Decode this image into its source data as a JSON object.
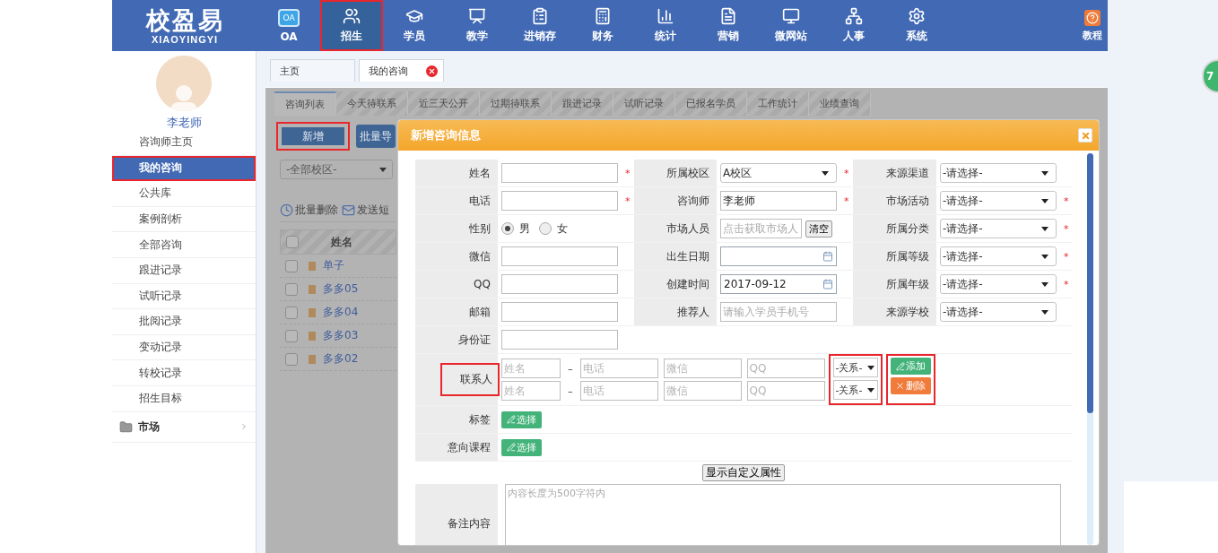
{
  "logo": {
    "title": "校盈易",
    "subtitle": "XIAOYINGYI"
  },
  "nav": [
    {
      "label": "OA",
      "icon_text": "OA",
      "selected": false,
      "highlighted": false
    },
    {
      "label": "招生",
      "selected": true,
      "highlighted": true
    },
    {
      "label": "学员",
      "selected": false,
      "highlighted": false
    },
    {
      "label": "教学",
      "selected": false,
      "highlighted": false
    },
    {
      "label": "进销存",
      "selected": false,
      "highlighted": false
    },
    {
      "label": "财务",
      "selected": false,
      "highlighted": false
    },
    {
      "label": "统计",
      "selected": false,
      "highlighted": false
    },
    {
      "label": "营销",
      "selected": false,
      "highlighted": false
    },
    {
      "label": "微网站",
      "selected": false,
      "highlighted": false
    },
    {
      "label": "人事",
      "selected": false,
      "highlighted": false
    },
    {
      "label": "系统",
      "selected": false,
      "highlighted": false
    }
  ],
  "help": {
    "label": "教程"
  },
  "user": {
    "name": "李老师"
  },
  "sidebar": {
    "items": [
      {
        "label": "咨询师主页",
        "selected": false,
        "highlighted": false
      },
      {
        "label": "我的咨询",
        "selected": true,
        "highlighted": true
      },
      {
        "label": "公共库",
        "selected": false,
        "highlighted": false
      },
      {
        "label": "案例剖析",
        "selected": false,
        "highlighted": false
      },
      {
        "label": "全部咨询",
        "selected": false,
        "highlighted": false
      },
      {
        "label": "跟进记录",
        "selected": false,
        "highlighted": false
      },
      {
        "label": "试听记录",
        "selected": false,
        "highlighted": false
      },
      {
        "label": "批阅记录",
        "selected": false,
        "highlighted": false
      },
      {
        "label": "变动记录",
        "selected": false,
        "highlighted": false
      },
      {
        "label": "转校记录",
        "selected": false,
        "highlighted": false
      },
      {
        "label": "招生目标",
        "selected": false,
        "highlighted": false
      }
    ],
    "group": {
      "label": "市场",
      "expanded": false
    }
  },
  "page_tabs": [
    {
      "label": "主页",
      "selected": false,
      "closable": false
    },
    {
      "label": "我的咨询",
      "selected": true,
      "closable": true
    }
  ],
  "sub_tabs": [
    {
      "label": "咨询列表",
      "selected": true
    },
    {
      "label": "今天待联系",
      "selected": false
    },
    {
      "label": "近三天公开",
      "selected": false
    },
    {
      "label": "过期待联系",
      "selected": false
    },
    {
      "label": "跟进记录",
      "selected": false
    },
    {
      "label": "试听记录",
      "selected": false
    },
    {
      "label": "已报名学员",
      "selected": false
    },
    {
      "label": "工作统计",
      "selected": false
    },
    {
      "label": "业绩查询",
      "selected": false
    }
  ],
  "toolbar": {
    "buttons": [
      {
        "label": "新增",
        "highlighted": true
      },
      {
        "label": "批量导",
        "highlighted": false
      }
    ],
    "campus_select": "-全部校区-",
    "actions": [
      "批量删除",
      "发送短"
    ]
  },
  "list": {
    "header": {
      "label": "姓名",
      "checked": false
    },
    "rows": [
      {
        "name": "单子",
        "checked": false
      },
      {
        "name": "多多05",
        "checked": false
      },
      {
        "name": "多多04",
        "checked": false
      },
      {
        "name": "多多03",
        "checked": false
      },
      {
        "name": "多多02",
        "checked": false
      }
    ]
  },
  "dialog": {
    "title": "新增咨询信息",
    "rows": [
      [
        {
          "kind": "text",
          "label": "姓名",
          "required_mark": "*"
        },
        {
          "kind": "select",
          "label": "所属校区",
          "value": "A校区",
          "required_mark": "*"
        },
        {
          "kind": "select",
          "label": "来源渠道",
          "value": "-请选择-"
        }
      ],
      [
        {
          "kind": "text",
          "label": "电话",
          "required_mark": "*"
        },
        {
          "kind": "text",
          "label": "咨询师",
          "value": "李老师",
          "required_mark": "*"
        },
        {
          "kind": "select",
          "label": "市场活动",
          "value": "-请选择-",
          "required_mark": "*"
        }
      ],
      [
        {
          "kind": "radio",
          "label": "性别",
          "options": [
            {
              "label": "男",
              "selected": true
            },
            {
              "label": "女",
              "selected": false
            }
          ]
        },
        {
          "kind": "picker",
          "label": "市场人员",
          "placeholder": "点击获取市场人",
          "button": "清空"
        },
        {
          "kind": "select",
          "label": "所属分类",
          "value": "-请选择-",
          "required_mark": "*"
        }
      ],
      [
        {
          "kind": "text",
          "label": "微信"
        },
        {
          "kind": "date",
          "label": "出生日期"
        },
        {
          "kind": "select",
          "label": "所属等级",
          "value": "-请选择-",
          "required_mark": "*"
        }
      ],
      [
        {
          "kind": "text",
          "label": "QQ"
        },
        {
          "kind": "date",
          "label": "创建时间",
          "value": "2017-09-12"
        },
        {
          "kind": "select",
          "label": "所属年级",
          "value": "-请选择-",
          "required_mark": "*"
        }
      ],
      [
        {
          "kind": "text",
          "label": "邮箱"
        },
        {
          "kind": "text",
          "label": "推荐人",
          "placeholder": "请输入学员手机号"
        },
        {
          "kind": "select",
          "label": "来源学校",
          "value": "-请选择-"
        }
      ],
      [
        {
          "kind": "text",
          "label": "身份证"
        }
      ]
    ],
    "contact": {
      "label": "联系人",
      "label_highlighted": true,
      "relation_highlighted": true,
      "actions_highlighted": true,
      "rows": [
        {
          "name_placeholder": "姓名",
          "dash": "–",
          "phone_placeholder": "电话",
          "wechat_placeholder": "微信",
          "qq_placeholder": "QQ",
          "relation": "-关系-"
        },
        {
          "name_placeholder": "姓名",
          "dash": "–",
          "phone_placeholder": "电话",
          "wechat_placeholder": "微信",
          "qq_placeholder": "QQ",
          "relation": "-关系-"
        }
      ],
      "actions": [
        {
          "kind": "add",
          "label": "添加"
        },
        {
          "kind": "delete",
          "label": "删除"
        }
      ]
    },
    "pickers": [
      {
        "label": "标签",
        "button": "选择"
      },
      {
        "label": "意向课程",
        "button": "选择"
      }
    ],
    "custom_button": "显示自定义属性",
    "remark": {
      "label": "备注内容",
      "placeholder": "内容长度为500字符内"
    }
  },
  "counter": "7"
}
